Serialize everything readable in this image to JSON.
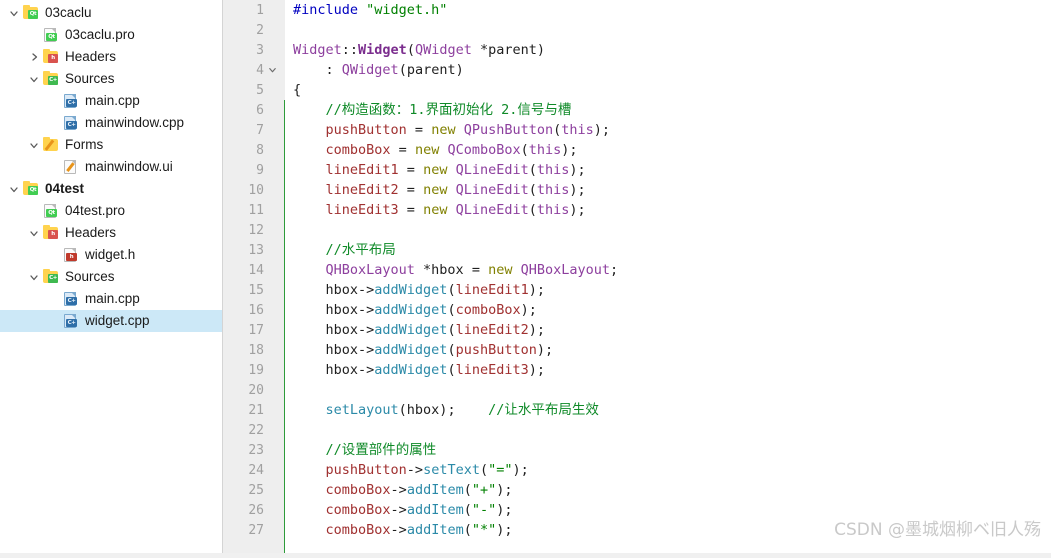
{
  "sidebar": {
    "items": [
      {
        "label": "03caclu",
        "indent": 0,
        "chevron": "down",
        "icon": "qt-project-folder-icon",
        "bold": false,
        "selected": false
      },
      {
        "label": "03caclu.pro",
        "indent": 1,
        "chevron": "none",
        "icon": "qt-pro-file-icon",
        "bold": false,
        "selected": false
      },
      {
        "label": "Headers",
        "indent": 1,
        "chevron": "right",
        "icon": "headers-folder-icon",
        "bold": false,
        "selected": false
      },
      {
        "label": "Sources",
        "indent": 1,
        "chevron": "down",
        "icon": "sources-folder-icon",
        "bold": false,
        "selected": false
      },
      {
        "label": "main.cpp",
        "indent": 2,
        "chevron": "none",
        "icon": "cpp-file-icon",
        "bold": false,
        "selected": false
      },
      {
        "label": "mainwindow.cpp",
        "indent": 2,
        "chevron": "none",
        "icon": "cpp-file-icon",
        "bold": false,
        "selected": false
      },
      {
        "label": "Forms",
        "indent": 1,
        "chevron": "down",
        "icon": "forms-folder-icon",
        "bold": false,
        "selected": false
      },
      {
        "label": "mainwindow.ui",
        "indent": 2,
        "chevron": "none",
        "icon": "ui-file-icon",
        "bold": false,
        "selected": false
      },
      {
        "label": "04test",
        "indent": 0,
        "chevron": "down",
        "icon": "qt-project-folder-icon",
        "bold": true,
        "selected": false
      },
      {
        "label": "04test.pro",
        "indent": 1,
        "chevron": "none",
        "icon": "qt-pro-file-icon",
        "bold": false,
        "selected": false
      },
      {
        "label": "Headers",
        "indent": 1,
        "chevron": "down",
        "icon": "headers-folder-icon",
        "bold": false,
        "selected": false
      },
      {
        "label": "widget.h",
        "indent": 2,
        "chevron": "none",
        "icon": "h-file-icon",
        "bold": false,
        "selected": false
      },
      {
        "label": "Sources",
        "indent": 1,
        "chevron": "down",
        "icon": "sources-folder-icon",
        "bold": false,
        "selected": false
      },
      {
        "label": "main.cpp",
        "indent": 2,
        "chevron": "none",
        "icon": "cpp-file-icon",
        "bold": false,
        "selected": false
      },
      {
        "label": "widget.cpp",
        "indent": 2,
        "chevron": "none",
        "icon": "cpp-file-icon",
        "bold": false,
        "selected": true
      }
    ]
  },
  "editor": {
    "first_line": 1,
    "fold_marker_line": 4,
    "block_bar_start_line": 6,
    "lines": [
      {
        "n": 1,
        "fold": "",
        "tokens": [
          {
            "t": "#include ",
            "c": "t-pre"
          },
          {
            "t": "\"widget.h\"",
            "c": "t-str"
          }
        ]
      },
      {
        "n": 2,
        "fold": "",
        "tokens": []
      },
      {
        "n": 3,
        "fold": "",
        "tokens": [
          {
            "t": "Widget",
            "c": "t-cls"
          },
          {
            "t": "::",
            "c": "t-punc"
          },
          {
            "t": "Widget",
            "c": "t-clsb"
          },
          {
            "t": "(",
            "c": "t-punc"
          },
          {
            "t": "QWidget",
            "c": "t-type"
          },
          {
            "t": " *parent)",
            "c": "t-punc"
          }
        ]
      },
      {
        "n": 4,
        "fold": "v",
        "tokens": [
          {
            "t": "    : ",
            "c": "t-punc"
          },
          {
            "t": "QWidget",
            "c": "t-type"
          },
          {
            "t": "(parent)",
            "c": "t-punc"
          }
        ]
      },
      {
        "n": 5,
        "fold": "",
        "tokens": [
          {
            "t": "{",
            "c": "t-punc"
          }
        ]
      },
      {
        "n": 6,
        "fold": "",
        "tokens": [
          {
            "t": "    //构造函数：1.界面初始化 2.信号与槽",
            "c": "t-com"
          }
        ]
      },
      {
        "n": 7,
        "fold": "",
        "tokens": [
          {
            "t": "    ",
            "c": "t-punc"
          },
          {
            "t": "pushButton",
            "c": "t-var"
          },
          {
            "t": " = ",
            "c": "t-punc"
          },
          {
            "t": "new",
            "c": "t-kw"
          },
          {
            "t": " ",
            "c": "t-punc"
          },
          {
            "t": "QPushButton",
            "c": "t-cls"
          },
          {
            "t": "(",
            "c": "t-punc"
          },
          {
            "t": "this",
            "c": "t-this"
          },
          {
            "t": ");",
            "c": "t-punc"
          }
        ]
      },
      {
        "n": 8,
        "fold": "",
        "tokens": [
          {
            "t": "    ",
            "c": "t-punc"
          },
          {
            "t": "comboBox",
            "c": "t-var"
          },
          {
            "t": " = ",
            "c": "t-punc"
          },
          {
            "t": "new",
            "c": "t-kw"
          },
          {
            "t": " ",
            "c": "t-punc"
          },
          {
            "t": "QComboBox",
            "c": "t-cls"
          },
          {
            "t": "(",
            "c": "t-punc"
          },
          {
            "t": "this",
            "c": "t-this"
          },
          {
            "t": ");",
            "c": "t-punc"
          }
        ]
      },
      {
        "n": 9,
        "fold": "",
        "tokens": [
          {
            "t": "    ",
            "c": "t-punc"
          },
          {
            "t": "lineEdit1",
            "c": "t-var"
          },
          {
            "t": " = ",
            "c": "t-punc"
          },
          {
            "t": "new",
            "c": "t-kw"
          },
          {
            "t": " ",
            "c": "t-punc"
          },
          {
            "t": "QLineEdit",
            "c": "t-cls"
          },
          {
            "t": "(",
            "c": "t-punc"
          },
          {
            "t": "this",
            "c": "t-this"
          },
          {
            "t": ");",
            "c": "t-punc"
          }
        ]
      },
      {
        "n": 10,
        "fold": "",
        "tokens": [
          {
            "t": "    ",
            "c": "t-punc"
          },
          {
            "t": "lineEdit2",
            "c": "t-var"
          },
          {
            "t": " = ",
            "c": "t-punc"
          },
          {
            "t": "new",
            "c": "t-kw"
          },
          {
            "t": " ",
            "c": "t-punc"
          },
          {
            "t": "QLineEdit",
            "c": "t-cls"
          },
          {
            "t": "(",
            "c": "t-punc"
          },
          {
            "t": "this",
            "c": "t-this"
          },
          {
            "t": ");",
            "c": "t-punc"
          }
        ]
      },
      {
        "n": 11,
        "fold": "",
        "tokens": [
          {
            "t": "    ",
            "c": "t-punc"
          },
          {
            "t": "lineEdit3",
            "c": "t-var"
          },
          {
            "t": " = ",
            "c": "t-punc"
          },
          {
            "t": "new",
            "c": "t-kw"
          },
          {
            "t": " ",
            "c": "t-punc"
          },
          {
            "t": "QLineEdit",
            "c": "t-cls"
          },
          {
            "t": "(",
            "c": "t-punc"
          },
          {
            "t": "this",
            "c": "t-this"
          },
          {
            "t": ");",
            "c": "t-punc"
          }
        ]
      },
      {
        "n": 12,
        "fold": "",
        "tokens": []
      },
      {
        "n": 13,
        "fold": "",
        "tokens": [
          {
            "t": "    //水平布局",
            "c": "t-com"
          }
        ]
      },
      {
        "n": 14,
        "fold": "",
        "tokens": [
          {
            "t": "    ",
            "c": "t-punc"
          },
          {
            "t": "QHBoxLayout",
            "c": "t-cls"
          },
          {
            "t": " *hbox = ",
            "c": "t-punc"
          },
          {
            "t": "new",
            "c": "t-kw"
          },
          {
            "t": " ",
            "c": "t-punc"
          },
          {
            "t": "QHBoxLayout",
            "c": "t-cls"
          },
          {
            "t": ";",
            "c": "t-punc"
          }
        ]
      },
      {
        "n": 15,
        "fold": "",
        "tokens": [
          {
            "t": "    hbox->",
            "c": "t-punc"
          },
          {
            "t": "addWidget",
            "c": "t-fn"
          },
          {
            "t": "(",
            "c": "t-punc"
          },
          {
            "t": "lineEdit1",
            "c": "t-var"
          },
          {
            "t": ");",
            "c": "t-punc"
          }
        ]
      },
      {
        "n": 16,
        "fold": "",
        "tokens": [
          {
            "t": "    hbox->",
            "c": "t-punc"
          },
          {
            "t": "addWidget",
            "c": "t-fn"
          },
          {
            "t": "(",
            "c": "t-punc"
          },
          {
            "t": "comboBox",
            "c": "t-var"
          },
          {
            "t": ");",
            "c": "t-punc"
          }
        ]
      },
      {
        "n": 17,
        "fold": "",
        "tokens": [
          {
            "t": "    hbox->",
            "c": "t-punc"
          },
          {
            "t": "addWidget",
            "c": "t-fn"
          },
          {
            "t": "(",
            "c": "t-punc"
          },
          {
            "t": "lineEdit2",
            "c": "t-var"
          },
          {
            "t": ");",
            "c": "t-punc"
          }
        ]
      },
      {
        "n": 18,
        "fold": "",
        "tokens": [
          {
            "t": "    hbox->",
            "c": "t-punc"
          },
          {
            "t": "addWidget",
            "c": "t-fn"
          },
          {
            "t": "(",
            "c": "t-punc"
          },
          {
            "t": "pushButton",
            "c": "t-var"
          },
          {
            "t": ");",
            "c": "t-punc"
          }
        ]
      },
      {
        "n": 19,
        "fold": "",
        "tokens": [
          {
            "t": "    hbox->",
            "c": "t-punc"
          },
          {
            "t": "addWidget",
            "c": "t-fn"
          },
          {
            "t": "(",
            "c": "t-punc"
          },
          {
            "t": "lineEdit3",
            "c": "t-var"
          },
          {
            "t": ");",
            "c": "t-punc"
          }
        ]
      },
      {
        "n": 20,
        "fold": "",
        "tokens": []
      },
      {
        "n": 21,
        "fold": "",
        "tokens": [
          {
            "t": "    ",
            "c": "t-punc"
          },
          {
            "t": "setLayout",
            "c": "t-fn"
          },
          {
            "t": "(hbox);    ",
            "c": "t-punc"
          },
          {
            "t": "//让水平布局生效",
            "c": "t-com"
          }
        ]
      },
      {
        "n": 22,
        "fold": "",
        "tokens": []
      },
      {
        "n": 23,
        "fold": "",
        "tokens": [
          {
            "t": "    //设置部件的属性",
            "c": "t-com"
          }
        ]
      },
      {
        "n": 24,
        "fold": "",
        "tokens": [
          {
            "t": "    ",
            "c": "t-punc"
          },
          {
            "t": "pushButton",
            "c": "t-var"
          },
          {
            "t": "->",
            "c": "t-punc"
          },
          {
            "t": "setText",
            "c": "t-fn"
          },
          {
            "t": "(",
            "c": "t-punc"
          },
          {
            "t": "\"=\"",
            "c": "t-str"
          },
          {
            "t": ");",
            "c": "t-punc"
          }
        ]
      },
      {
        "n": 25,
        "fold": "",
        "tokens": [
          {
            "t": "    ",
            "c": "t-punc"
          },
          {
            "t": "comboBox",
            "c": "t-var"
          },
          {
            "t": "->",
            "c": "t-punc"
          },
          {
            "t": "addItem",
            "c": "t-fn"
          },
          {
            "t": "(",
            "c": "t-punc"
          },
          {
            "t": "\"+\"",
            "c": "t-str"
          },
          {
            "t": ");",
            "c": "t-punc"
          }
        ]
      },
      {
        "n": 26,
        "fold": "",
        "tokens": [
          {
            "t": "    ",
            "c": "t-punc"
          },
          {
            "t": "comboBox",
            "c": "t-var"
          },
          {
            "t": "->",
            "c": "t-punc"
          },
          {
            "t": "addItem",
            "c": "t-fn"
          },
          {
            "t": "(",
            "c": "t-punc"
          },
          {
            "t": "\"-\"",
            "c": "t-str"
          },
          {
            "t": ");",
            "c": "t-punc"
          }
        ]
      },
      {
        "n": 27,
        "fold": "",
        "tokens": [
          {
            "t": "    ",
            "c": "t-punc"
          },
          {
            "t": "comboBox",
            "c": "t-var"
          },
          {
            "t": "->",
            "c": "t-punc"
          },
          {
            "t": "addItem",
            "c": "t-fn"
          },
          {
            "t": "(",
            "c": "t-punc"
          },
          {
            "t": "\"*\"",
            "c": "t-str"
          },
          {
            "t": ");",
            "c": "t-punc"
          }
        ]
      }
    ]
  },
  "watermark": {
    "text": "CSDN @墨城烟柳ベ旧人殇"
  },
  "colors": {
    "selection": "#cce8f7",
    "gutter_bg": "#eeeeee",
    "block_bar": "#2e9b3a",
    "comment": "#0f8a28",
    "string": "#008000",
    "keyword": "#808000",
    "class": "#8d3f9e",
    "member": "#a03030",
    "function": "#2b8aa8",
    "preprocessor": "#0000c0"
  }
}
